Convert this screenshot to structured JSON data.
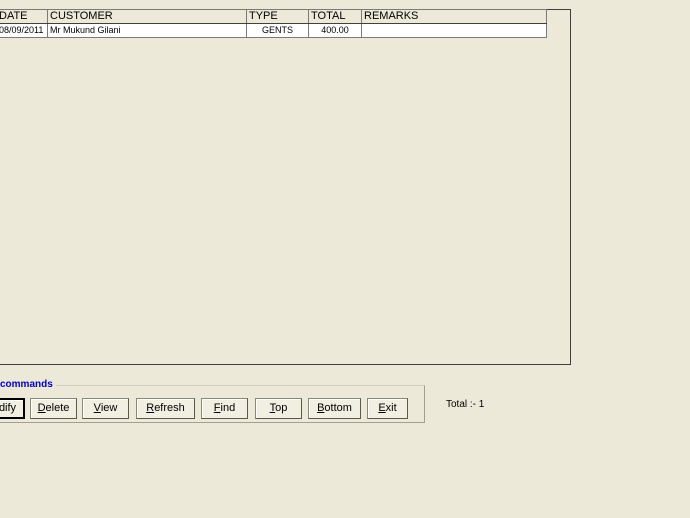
{
  "grid": {
    "columns": [
      "DATE",
      "CUSTOMER",
      "TYPE",
      "TOTAL",
      "REMARKS"
    ],
    "rows": [
      {
        "date": "08/09/2011",
        "customer": "Mr Mukund Gilani",
        "type": "GENTS",
        "total": "400.00",
        "remarks": ""
      }
    ]
  },
  "commands": {
    "legend": "commands",
    "buttons": [
      {
        "label": "dify",
        "hotkey": ""
      },
      {
        "label": "Delete",
        "hotkey": "D"
      },
      {
        "label": "View",
        "hotkey": "V"
      },
      {
        "label": "Refresh",
        "hotkey": "R"
      },
      {
        "label": "Find",
        "hotkey": "F"
      },
      {
        "label": "Top",
        "hotkey": "T"
      },
      {
        "label": "Bottom",
        "hotkey": "B"
      },
      {
        "label": "Exit",
        "hotkey": "E"
      }
    ]
  },
  "status": {
    "total_text": "Total :-  1"
  }
}
